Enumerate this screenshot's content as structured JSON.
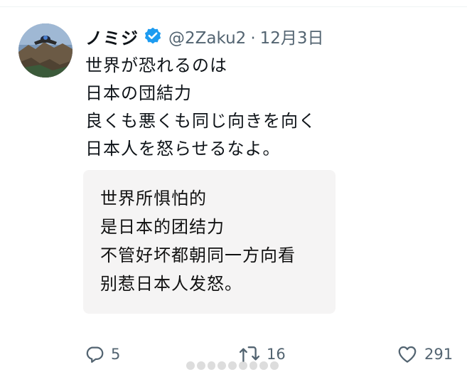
{
  "tweet": {
    "author": {
      "display_name": "ノミジ",
      "handle": "@2Zaku2",
      "verified": true,
      "verified_color": "#1d9bf0"
    },
    "separator": "·",
    "date": "12月3日",
    "text_lines": [
      "世界が恐れるのは",
      "日本の団結力",
      "良くも悪くも同じ向きを向く",
      "日本人を怒らせるなよ。"
    ],
    "translation_lines": [
      "世界所惧怕的",
      "是日本的团结力",
      "不管好坏都朝同一方向看",
      "别惹日本人发怒。"
    ]
  },
  "actions": {
    "reply": {
      "icon": "reply-icon",
      "count": "5"
    },
    "retweet": {
      "icon": "retweet-icon",
      "count": "16"
    },
    "like": {
      "icon": "heart-icon",
      "count": "291"
    }
  },
  "colors": {
    "text": "#0f1419",
    "muted": "#536471",
    "card_bg": "#f5f4f4",
    "verified": "#1d9bf0"
  }
}
